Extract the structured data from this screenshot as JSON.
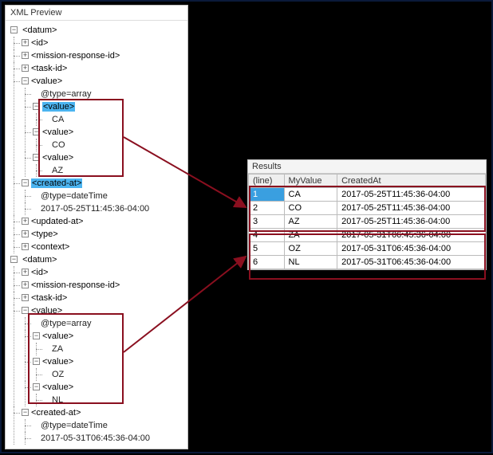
{
  "xml_preview": {
    "title": "XML Preview",
    "datum1": {
      "tag": "<datum>",
      "id": "<id>",
      "mission": "<mission-response-id>",
      "task": "<task-id>",
      "value_tag": "<value>",
      "type_attr": "@type=array",
      "inner_value_tag": "<value>",
      "vals": {
        "ca": "CA",
        "co": "CO",
        "az": "AZ"
      },
      "created_tag": "<created-at>",
      "created_type": "@type=dateTime",
      "created_val": "2017-05-25T11:45:36-04:00",
      "updated": "<updated-at>",
      "type": "<type>",
      "context": "<context>"
    },
    "datum2": {
      "tag": "<datum>",
      "id": "<id>",
      "mission": "<mission-response-id>",
      "task": "<task-id>",
      "value_tag": "<value>",
      "type_attr": "@type=array",
      "inner_value_tag": "<value>",
      "vals": {
        "za": "ZA",
        "oz": "OZ",
        "nl": "NL"
      },
      "created_tag": "<created-at>",
      "created_type": "@type=dateTime",
      "created_val": "2017-05-31T06:45:36-04:00"
    }
  },
  "results": {
    "title": "Results",
    "headers": {
      "line": "(line)",
      "myvalue": "MyValue",
      "createdat": "CreatedAt"
    },
    "rows": [
      {
        "line": "1",
        "myvalue": "CA",
        "createdat": "2017-05-25T11:45:36-04:00"
      },
      {
        "line": "2",
        "myvalue": "CO",
        "createdat": "2017-05-25T11:45:36-04:00"
      },
      {
        "line": "3",
        "myvalue": "AZ",
        "createdat": "2017-05-25T11:45:36-04:00"
      },
      {
        "line": "4",
        "myvalue": "ZA",
        "createdat": "2017-05-31T06:45:36-04:00"
      },
      {
        "line": "5",
        "myvalue": "OZ",
        "createdat": "2017-05-31T06:45:36-04:00"
      },
      {
        "line": "6",
        "myvalue": "NL",
        "createdat": "2017-05-31T06:45:36-04:00"
      }
    ]
  }
}
